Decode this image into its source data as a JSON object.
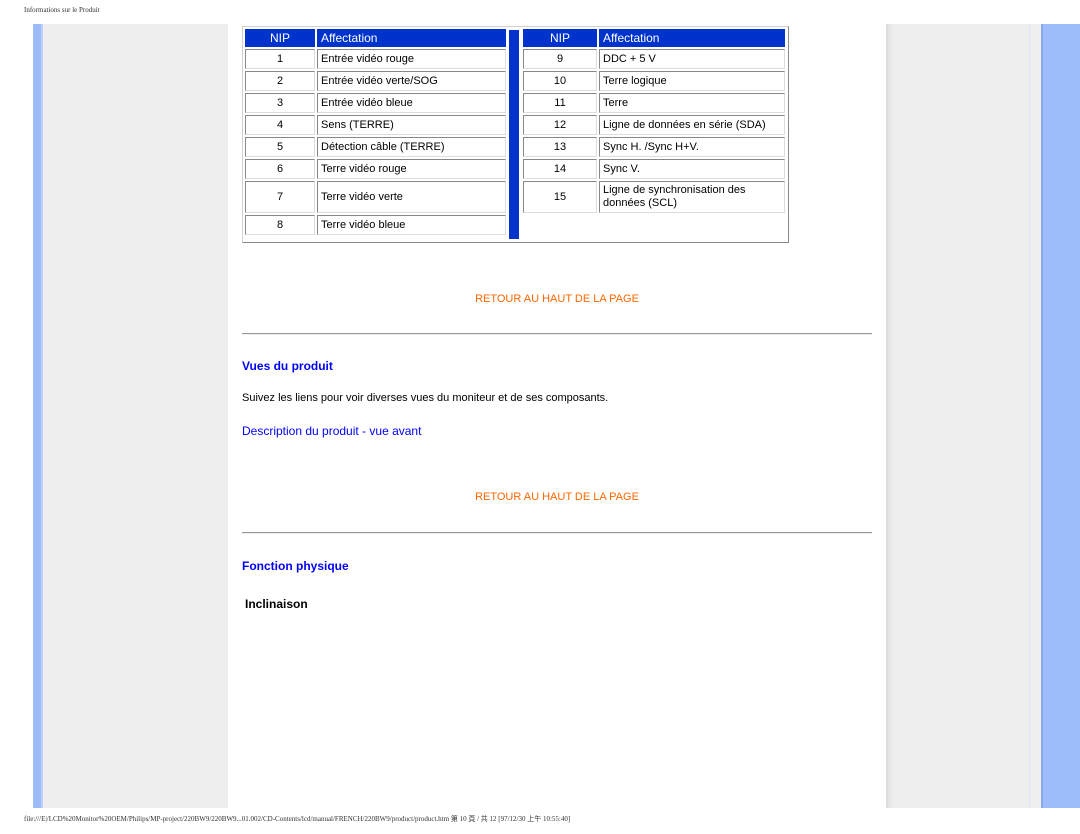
{
  "print_header": "Informations sur le Produit",
  "print_footer": "file:///E|/LCD%20Monitor%20OEM/Philips/MP-project/220BW9/220BW9...01.002/CD-Contents/lcd/manual/FRENCH/220BW9/product/product.htm 第 10 頁 / 共 12  [97/12/30 上午 10:55:40]",
  "pin_table": {
    "headers": {
      "nip": "NIP",
      "affectation": "Affectation"
    },
    "left": [
      {
        "nip": "1",
        "label": "Entrée vidéo rouge"
      },
      {
        "nip": "2",
        "label": "Entrée vidéo verte/SOG"
      },
      {
        "nip": "3",
        "label": "Entrée vidéo bleue"
      },
      {
        "nip": "4",
        "label": "Sens (TERRE)"
      },
      {
        "nip": "5",
        "label": "Détection câble (TERRE)"
      },
      {
        "nip": "6",
        "label": "Terre vidéo rouge"
      },
      {
        "nip": "7",
        "label": "Terre vidéo verte"
      },
      {
        "nip": "8",
        "label": "Terre vidéo bleue"
      }
    ],
    "right": [
      {
        "nip": "9",
        "label": "DDC + 5 V"
      },
      {
        "nip": "10",
        "label": "Terre logique"
      },
      {
        "nip": "11",
        "label": "Terre"
      },
      {
        "nip": "12",
        "label": "Ligne de données en série (SDA)"
      },
      {
        "nip": "13",
        "label": "Sync H. /Sync H+V."
      },
      {
        "nip": "14",
        "label": "Sync V."
      },
      {
        "nip": "15",
        "label": "Ligne de synchronisation des données (SCL)"
      }
    ]
  },
  "back_to_top_1": "RETOUR AU HAUT DE LA PAGE",
  "section_views": {
    "title": "Vues du produit",
    "text": "Suivez les liens pour voir diverses vues du moniteur et de ses composants.",
    "link": "Description du produit - vue avant"
  },
  "back_to_top_2": "RETOUR AU HAUT DE LA PAGE",
  "section_physical": {
    "title": "Fonction physique",
    "subtitle": "Inclinaison"
  },
  "colors": {
    "header_blue": "#0033cc",
    "link_orange": "#ff6600",
    "link_blue": "#0000ff",
    "frame_blue": "#9cbcfa"
  }
}
